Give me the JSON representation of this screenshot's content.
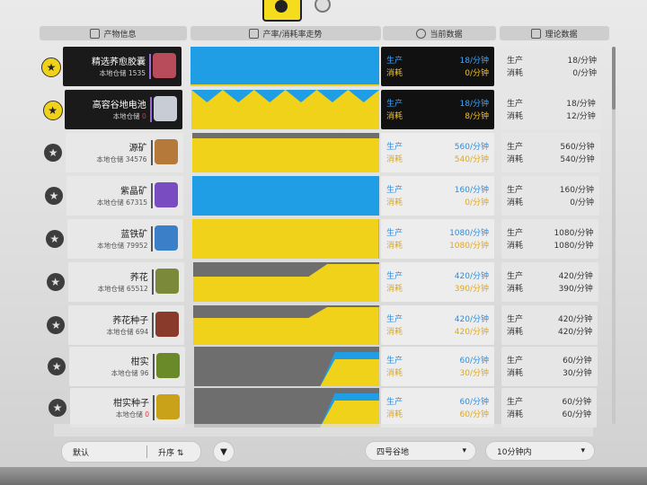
{
  "header": {
    "product": "产物信息",
    "trend": "产率/消耗率走势",
    "current": "当前数据",
    "theory": "理论数据"
  },
  "labels": {
    "production": "生产",
    "consumption": "消耗"
  },
  "items": [
    {
      "name": "精选荞愈胶囊",
      "stock_label": "本地仓储",
      "stock": "1535",
      "favorite": true,
      "current_prod": "18/分钟",
      "current_cons": "0/分钟",
      "theory_prod": "18/分钟",
      "theory_cons": "0/分钟",
      "icon": "capsule-box-icon",
      "icon_color": "#b84c5a"
    },
    {
      "name": "高容谷地电池",
      "stock_label": "本地仓储",
      "stock": "0",
      "favorite": true,
      "current_prod": "18/分钟",
      "current_cons": "8/分钟",
      "theory_prod": "18/分钟",
      "theory_cons": "12/分钟",
      "icon": "battery-icon",
      "icon_color": "#c8ccd4"
    },
    {
      "name": "源矿",
      "stock_label": "本地仓储",
      "stock": "34576",
      "favorite": false,
      "current_prod": "560/分钟",
      "current_cons": "540/分钟",
      "theory_prod": "560/分钟",
      "theory_cons": "540/分钟",
      "icon": "ore-icon",
      "icon_color": "#b57a3a"
    },
    {
      "name": "紫晶矿",
      "stock_label": "本地仓储",
      "stock": "67315",
      "favorite": false,
      "current_prod": "160/分钟",
      "current_cons": "0/分钟",
      "theory_prod": "160/分钟",
      "theory_cons": "0/分钟",
      "icon": "amethyst-icon",
      "icon_color": "#7a4cc2"
    },
    {
      "name": "蓝铁矿",
      "stock_label": "本地仓储",
      "stock": "79952",
      "favorite": false,
      "current_prod": "1080/分钟",
      "current_cons": "1080/分钟",
      "theory_prod": "1080/分钟",
      "theory_cons": "1080/分钟",
      "icon": "blue-iron-icon",
      "icon_color": "#3a7fc8"
    },
    {
      "name": "荞花",
      "stock_label": "本地仓储",
      "stock": "65512",
      "favorite": false,
      "current_prod": "420/分钟",
      "current_cons": "390/分钟",
      "theory_prod": "420/分钟",
      "theory_cons": "390/分钟",
      "icon": "flower-icon",
      "icon_color": "#7a8a3a"
    },
    {
      "name": "荞花种子",
      "stock_label": "本地仓储",
      "stock": "694",
      "favorite": false,
      "current_prod": "420/分钟",
      "current_cons": "420/分钟",
      "theory_prod": "420/分钟",
      "theory_cons": "420/分钟",
      "icon": "seed-icon",
      "icon_color": "#8a3a2a"
    },
    {
      "name": "柑实",
      "stock_label": "本地仓储",
      "stock": "96",
      "favorite": false,
      "current_prod": "60/分钟",
      "current_cons": "30/分钟",
      "theory_prod": "60/分钟",
      "theory_cons": "30/分钟",
      "icon": "citrus-plant-icon",
      "icon_color": "#6a8a2a"
    },
    {
      "name": "柑实种子",
      "stock_label": "本地仓储",
      "stock": "0",
      "favorite": false,
      "current_prod": "60/分钟",
      "current_cons": "60/分钟",
      "theory_prod": "60/分钟",
      "theory_cons": "60/分钟",
      "icon": "citrus-seed-icon",
      "icon_color": "#c9a21a"
    }
  ],
  "controls": {
    "sort_field": "默认",
    "sort_order": "升序",
    "region": "四号谷地",
    "range": "10分钟内"
  },
  "colors": {
    "production": "#1f9ee6",
    "consumption": "#f0d21a",
    "idle": "#6e6e6e"
  }
}
